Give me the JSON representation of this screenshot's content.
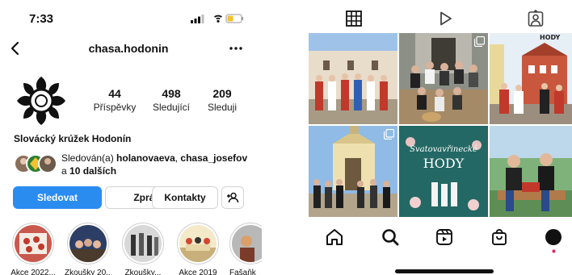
{
  "status_bar": {
    "time": "7:33"
  },
  "header": {
    "username": "chasa.hodonin"
  },
  "profile": {
    "stats": [
      {
        "value": "44",
        "label": "Příspěvky"
      },
      {
        "value": "498",
        "label": "Sledující"
      },
      {
        "value": "209",
        "label": "Sleduji"
      }
    ],
    "name": "Slovácký krúžek Hodonín",
    "followed_by": {
      "prefix": "Sledován(a) ",
      "user1": "holanovaeva",
      "separator": ", ",
      "user2": "chasa_josefov",
      "line2_prefix": "a ",
      "others": "10 dalších"
    }
  },
  "actions": {
    "follow_label": "Sledovat",
    "message_label": "Zpráva",
    "contacts_label": "Kontakty"
  },
  "highlights": [
    {
      "label": "Akce 2022..."
    },
    {
      "label": "Zkoušky 20..."
    },
    {
      "label": "Zkoušky..."
    },
    {
      "label": "Akce 2019"
    },
    {
      "label": "Fašaňk"
    }
  ],
  "posts": {
    "tile6_text_line1": "Svatovavřinecké",
    "tile6_text_line2": "HODY",
    "tile3_text": "HODY"
  },
  "colors": {
    "follow_button": "#2b8cf0",
    "battery": "#f2c230",
    "notification_dot": "#e0245e"
  },
  "icons": {
    "top_tabs": [
      "grid-icon",
      "reels-play-icon",
      "tagged-person-icon"
    ],
    "bottom_nav": [
      "home-icon",
      "search-icon",
      "reels-icon",
      "shop-bag-icon",
      "profile-avatar-icon"
    ]
  }
}
